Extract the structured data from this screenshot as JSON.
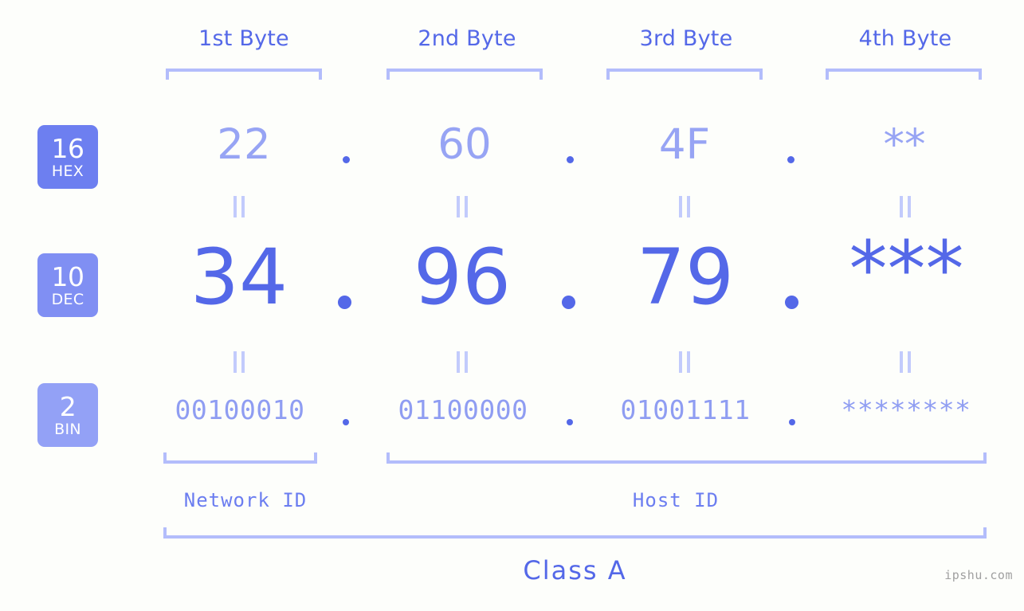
{
  "background_color": "#fdfefb",
  "accent_color": "#5468e8",
  "light_accent_color": "#b3bdfb",
  "headers": [
    {
      "label": "1st Byte"
    },
    {
      "label": "2nd Byte"
    },
    {
      "label": "3rd Byte"
    },
    {
      "label": "4th Byte"
    }
  ],
  "rows": {
    "hex": {
      "badge_number": "16",
      "badge_label": "HEX",
      "badge_color": "#6d7ff0",
      "values": [
        "22",
        "60",
        "4F",
        "**"
      ]
    },
    "dec": {
      "badge_number": "10",
      "badge_label": "DEC",
      "badge_color": "#808ff3",
      "values": [
        "34",
        "96",
        "79",
        "***"
      ]
    },
    "bin": {
      "badge_number": "2",
      "badge_label": "BIN",
      "badge_color": "#93a1f6",
      "values": [
        "00100010",
        "01100000",
        "01001111",
        "********"
      ]
    }
  },
  "separator": ".",
  "equality_symbol": "=",
  "segments": {
    "network_id": "Network ID",
    "host_id": "Host ID",
    "class": "Class A"
  },
  "watermark": "ipshu.com"
}
